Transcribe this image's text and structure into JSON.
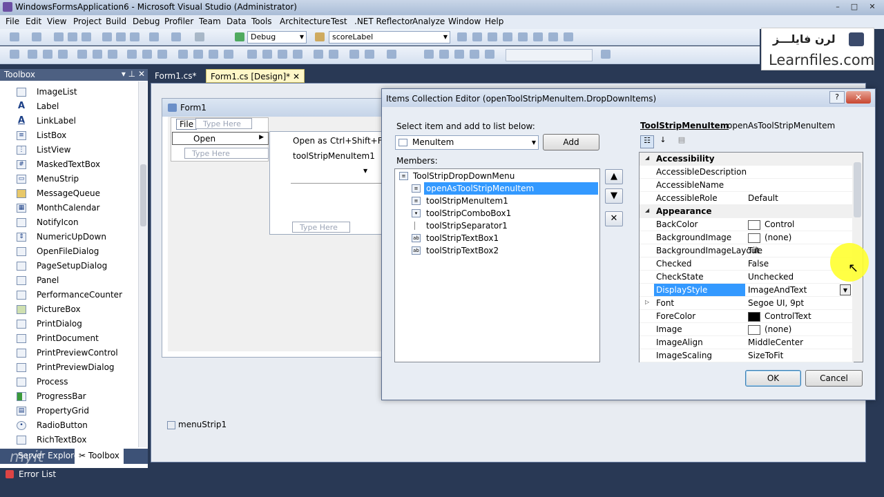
{
  "window": {
    "title": "WindowsFormsApplication6 - Microsoft Visual Studio (Administrator)"
  },
  "menubar": [
    "File",
    "Edit",
    "View",
    "Project",
    "Build",
    "Debug",
    "Profiler",
    "Team",
    "Data",
    "Tools",
    "Architecture",
    "Test",
    ".NET Reflector",
    "Analyze",
    "Window",
    "Help"
  ],
  "toolbar": {
    "config": "Debug",
    "target": "scoreLabel"
  },
  "logo": {
    "persian": "لرن فایلـــز",
    "english": "Learnfiles.com"
  },
  "toolbox": {
    "title": "Toolbox",
    "items": [
      "ImageList",
      "Label",
      "LinkLabel",
      "ListBox",
      "ListView",
      "MaskedTextBox",
      "MenuStrip",
      "MessageQueue",
      "MonthCalendar",
      "NotifyIcon",
      "NumericUpDown",
      "OpenFileDialog",
      "PageSetupDialog",
      "Panel",
      "PerformanceCounter",
      "PictureBox",
      "PrintDialog",
      "PrintDocument",
      "PrintPreviewControl",
      "PrintPreviewDialog",
      "Process",
      "ProgressBar",
      "PropertyGrid",
      "RadioButton",
      "RichTextBox"
    ],
    "tab_server": "Server Explorer",
    "tab_toolbox": "Toolbox",
    "error_list": "Error List"
  },
  "doctabs": {
    "tab1": "Form1.cs*",
    "tab2": "Form1.cs [Design]*"
  },
  "designer": {
    "form_title": "Form1",
    "menu_file": "File",
    "type_here": "Type Here",
    "menu_open": "Open",
    "open_as": "Open as",
    "shortcut": "Ctrl+Shift+F",
    "tsmi1": "toolStripMenuItem1",
    "component": "menuStrip1"
  },
  "dialog": {
    "title": "Items Collection Editor (openToolStripMenuItem.DropDownItems)",
    "select_label": "Select item and add to list below:",
    "type_combo": "MenuItem",
    "add": "Add",
    "members_label": "Members:",
    "members": [
      {
        "name": "ToolStripDropDownMenu",
        "icon": "dropdown-menu-icon",
        "glyph": "≡"
      },
      {
        "name": "openAsToolStripMenuItem",
        "icon": "menu-item-icon",
        "glyph": "≡"
      },
      {
        "name": "toolStripMenuItem1",
        "icon": "menu-item-icon",
        "glyph": "≡"
      },
      {
        "name": "toolStripComboBox1",
        "icon": "combobox-icon",
        "glyph": "▾"
      },
      {
        "name": "toolStripSeparator1",
        "icon": "separator-icon",
        "glyph": ""
      },
      {
        "name": "toolStripTextBox1",
        "icon": "textbox-icon",
        "glyph": "ab"
      },
      {
        "name": "toolStripTextBox2",
        "icon": "textbox-icon",
        "glyph": "ab"
      }
    ],
    "object_type": "ToolStripMenuItem",
    "object_name": "openAsToolStripMenuItem",
    "ok": "OK",
    "cancel": "Cancel"
  },
  "properties": [
    {
      "cat": true,
      "name": "Accessibility"
    },
    {
      "name": "AccessibleDescription",
      "value": ""
    },
    {
      "name": "AccessibleName",
      "value": ""
    },
    {
      "name": "AccessibleRole",
      "value": "Default"
    },
    {
      "cat": true,
      "name": "Appearance"
    },
    {
      "name": "BackColor",
      "value": "Control",
      "swatch": "#ffffff"
    },
    {
      "name": "BackgroundImage",
      "value": "(none)",
      "swatch": "#ffffff"
    },
    {
      "name": "BackgroundImageLayout",
      "value": "Tile"
    },
    {
      "name": "Checked",
      "value": "False"
    },
    {
      "name": "CheckState",
      "value": "Unchecked"
    },
    {
      "name": "DisplayStyle",
      "value": "ImageAndText",
      "selected": true
    },
    {
      "name": "Font",
      "value": "Segoe UI, 9pt",
      "expand": true
    },
    {
      "name": "ForeColor",
      "value": "ControlText",
      "swatch": "#000000"
    },
    {
      "name": "Image",
      "value": "(none)",
      "swatch": "#ffffff"
    },
    {
      "name": "ImageAlign",
      "value": "MiddleCenter"
    },
    {
      "name": "ImageScaling",
      "value": "SizeToFit"
    }
  ],
  "colors": {
    "selection": "#3399ff",
    "chrome": "#293955",
    "accent": "#4d6082"
  }
}
